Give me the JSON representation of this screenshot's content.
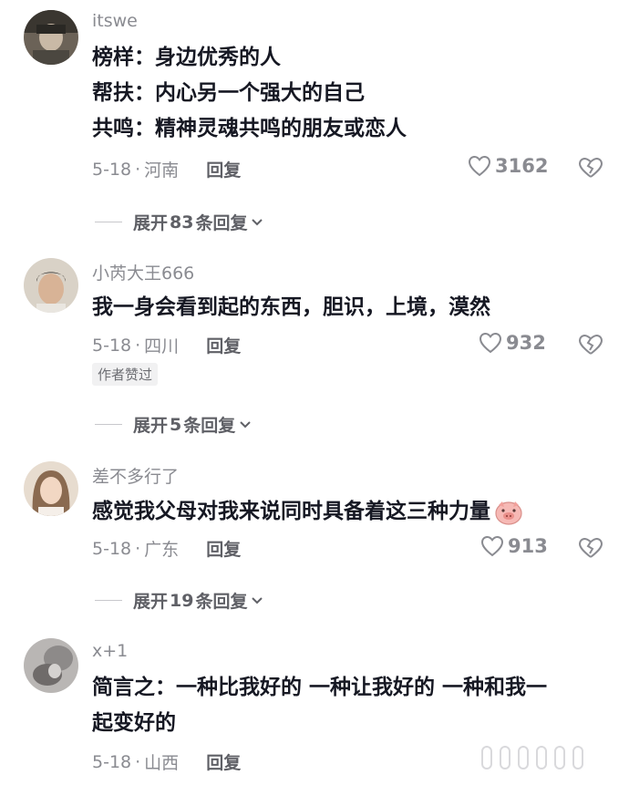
{
  "comments": [
    {
      "username": "itswe",
      "content_lines": [
        "榜样：身边优秀的人",
        "帮扶：内心另一个强大的自己",
        "共鸣：精神灵魂共鸣的朋友或恋人"
      ],
      "date": "5-18",
      "location": "河南",
      "reply_label": "回复",
      "likes": "3162",
      "expand_prefix": "展开",
      "expand_count": "83",
      "expand_suffix": "条回复"
    },
    {
      "username": "小芮大王666",
      "content_lines": [
        "我一身会看到起的东西，胆识，上境，漠然"
      ],
      "date": "5-18",
      "location": "四川",
      "reply_label": "回复",
      "likes": "932",
      "badge": "作者赞过",
      "expand_prefix": "展开",
      "expand_count": "5",
      "expand_suffix": "条回复"
    },
    {
      "username": "差不多行了",
      "content_lines": [
        "感觉我父母对我来说同时具备着这三种力量"
      ],
      "date": "5-18",
      "location": "广东",
      "reply_label": "回复",
      "likes": "913",
      "emoji": "pig-face",
      "expand_prefix": "展开",
      "expand_count": "19",
      "expand_suffix": "条回复"
    },
    {
      "username": "x+1",
      "content_lines": [
        "简言之：一种比我好的 一种让我好的 一种和我一",
        "起变好的"
      ],
      "date": "5-18",
      "location": "山西",
      "reply_label": "回复"
    }
  ],
  "icons": {
    "like": "heart-outline-icon",
    "dislike": "broken-heart-icon",
    "expand": "chevron-down-icon"
  },
  "colors": {
    "text_primary": "#161823",
    "text_secondary": "#8a8b91"
  }
}
